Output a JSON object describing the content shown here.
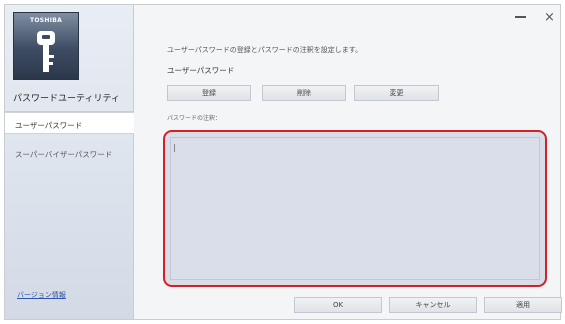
{
  "app": {
    "logo_text": "TOSHIBA",
    "title": "パスワードユーティリティ"
  },
  "sidebar": {
    "items": [
      {
        "label": "ユーザーパスワード",
        "active": true
      },
      {
        "label": "スーパーバイザーパスワード",
        "active": false
      }
    ],
    "version_link": "バージョン情報"
  },
  "window_controls": {
    "minimize": "_",
    "close": "×"
  },
  "main": {
    "description": "ユーザーパスワードの登録とパスワードの注釈を設定します。",
    "section_label": "ユーザーパスワード",
    "buttons": {
      "register": "登録",
      "delete": "削除",
      "change": "変更"
    },
    "hint_label": "パスワードの注釈：",
    "hint_value": ""
  },
  "footer": {
    "ok": "OK",
    "cancel": "キャンセル",
    "apply": "適用"
  },
  "colors": {
    "highlight": "#d5202a",
    "link": "#2f55a8"
  }
}
